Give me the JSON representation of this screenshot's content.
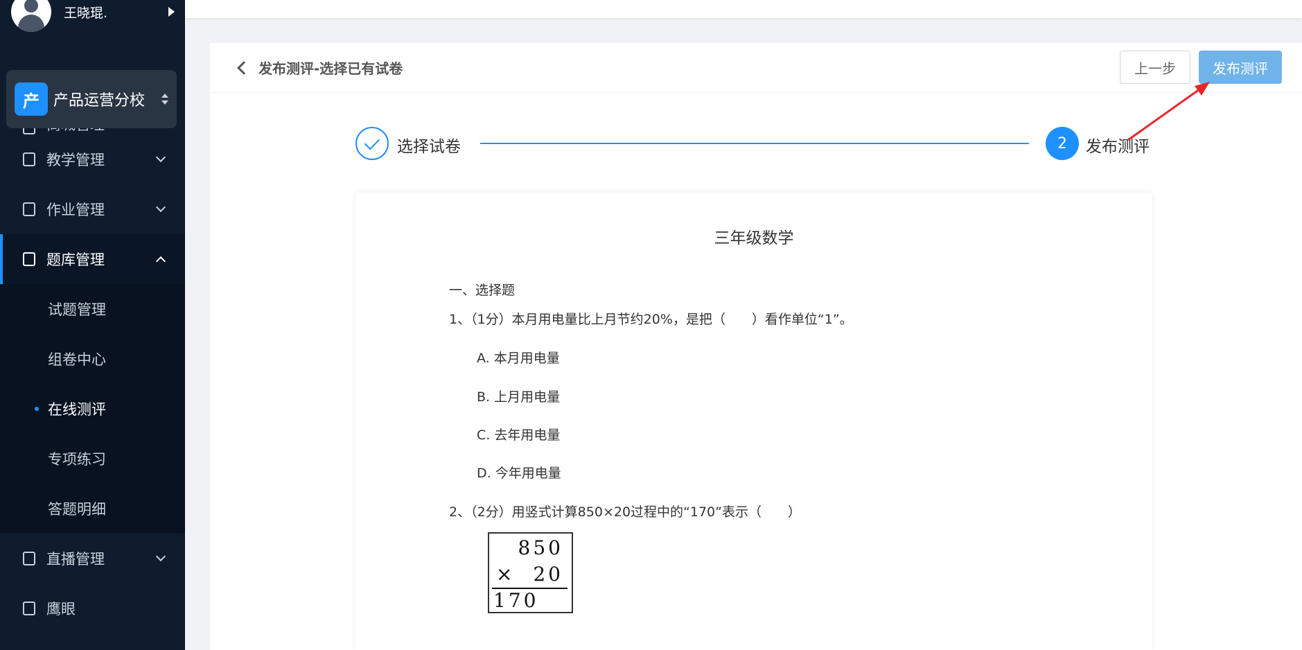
{
  "user": {
    "name": "王晓琨."
  },
  "org": {
    "logo_char": "产",
    "name": "产品运营分校"
  },
  "menu": {
    "partial_label": "商城管理",
    "items": [
      {
        "label": "教学管理"
      },
      {
        "label": "作业管理"
      },
      {
        "label": "题库管理"
      }
    ],
    "sub_items": [
      {
        "label": "试题管理"
      },
      {
        "label": "组卷中心"
      },
      {
        "label": "在线测评"
      },
      {
        "label": "专项练习"
      },
      {
        "label": "答题明细"
      }
    ],
    "after_items": [
      {
        "label": "直播管理"
      },
      {
        "label": "鹰眼"
      }
    ]
  },
  "header": {
    "title": "发布测评-选择已有试卷",
    "prev_label": "上一步",
    "publish_label": "发布测评"
  },
  "steps": {
    "step1_label": "选择试卷",
    "step2_number": "2",
    "step2_label": "发布测评"
  },
  "paper": {
    "title": "三年级数学",
    "section": "一、选择题",
    "q1": {
      "text": "1、（1分）本月用电量比上月节约20%，是把（　　）看作单位“1”。",
      "options": [
        "A. 本月用电量",
        "B. 上月用电量",
        "C. 去年用电量",
        "D. 今年用电量"
      ]
    },
    "q2": {
      "text": "2、（2分）用竖式计算850×20过程中的“170”表示（　　）",
      "calc_line1": "850",
      "calc_op": "×",
      "calc_line2": "20",
      "calc_line3": "170"
    }
  },
  "colors": {
    "accent": "#1e90ff",
    "sidebar": "#0f1c2e",
    "publish_button": "#6fb3ea",
    "annotation": "#e8262a"
  }
}
